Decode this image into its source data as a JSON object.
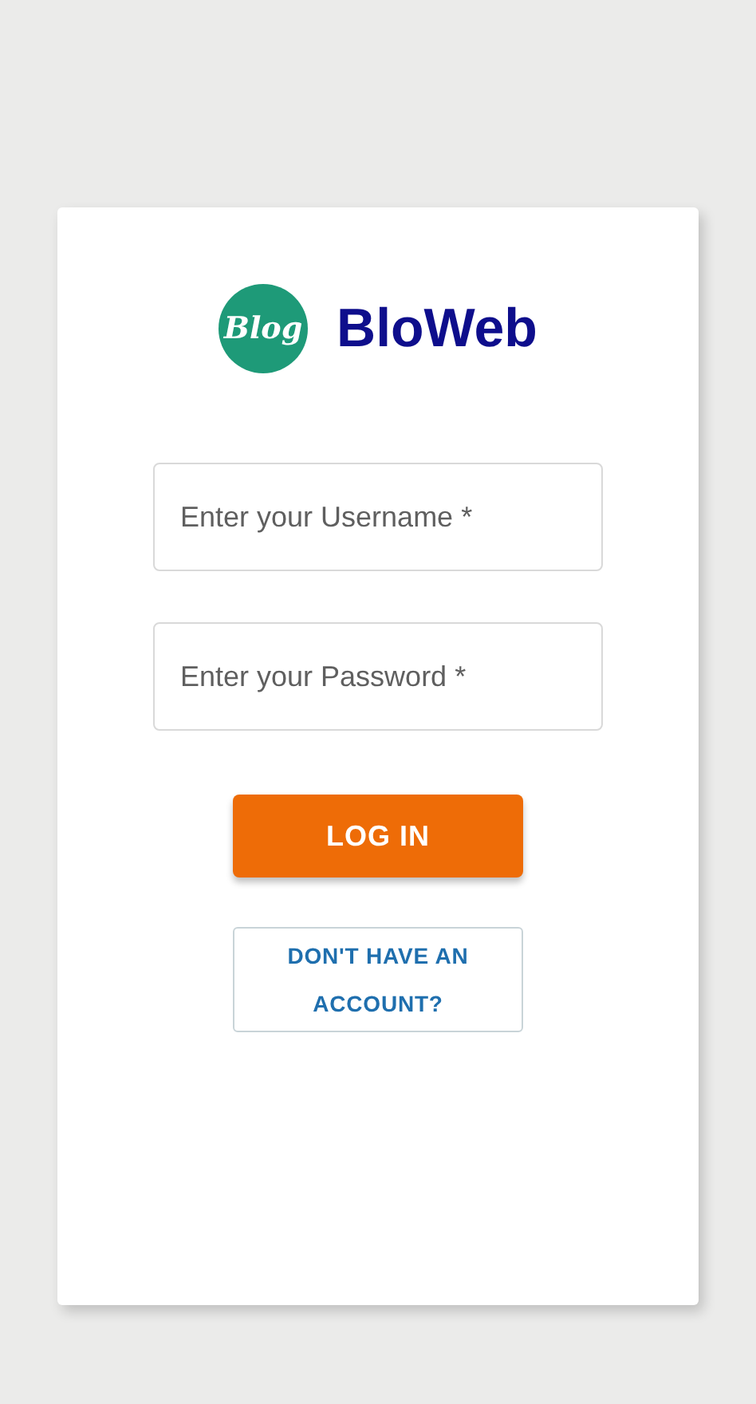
{
  "logo": {
    "badge_text": "Blog",
    "title": "BloWeb"
  },
  "fields": [
    {
      "placeholder": "Enter your Username *"
    },
    {
      "placeholder": "Enter your Password *"
    }
  ],
  "login_button": {
    "label": "LOG IN"
  },
  "signup_button": {
    "label": "DON'T HAVE AN ACCOUNT?"
  }
}
